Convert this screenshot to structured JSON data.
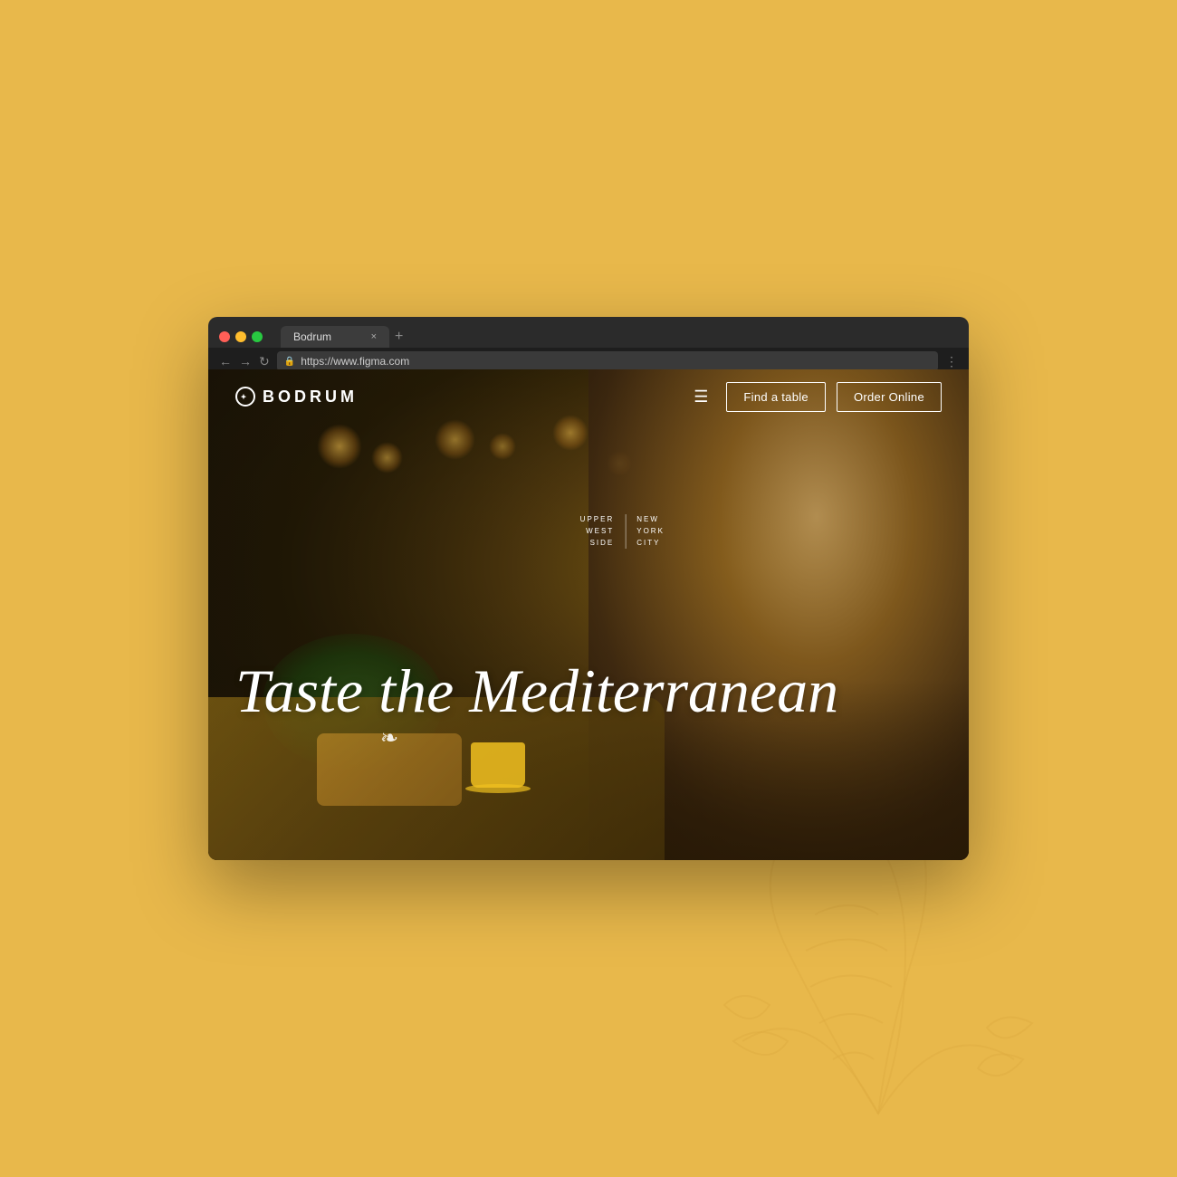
{
  "page": {
    "background_color": "#E8B84B"
  },
  "browser": {
    "tab_title": "Bodrum",
    "url": "https://www.figma.com",
    "traffic_lights": {
      "red_label": "close",
      "yellow_label": "minimize",
      "green_label": "maximize"
    },
    "nav_back": "←",
    "nav_forward": "→",
    "nav_refresh": "↻",
    "more_options": "⋮",
    "tab_close": "×",
    "tab_new": "+"
  },
  "website": {
    "logo_text": "BODRUM",
    "logo_circle": "○",
    "nav_hamburger": "☰",
    "nav_find_table": "Find a table",
    "nav_order_online": "Order Online",
    "location_line1": "UPPER",
    "location_line2": "WEST",
    "location_line3": "SIDE",
    "location_right1": "NEW",
    "location_right2": "YORK",
    "location_right3": "CITY",
    "hero_heading": "Taste the Mediterranean",
    "hero_flourish": "❧"
  }
}
